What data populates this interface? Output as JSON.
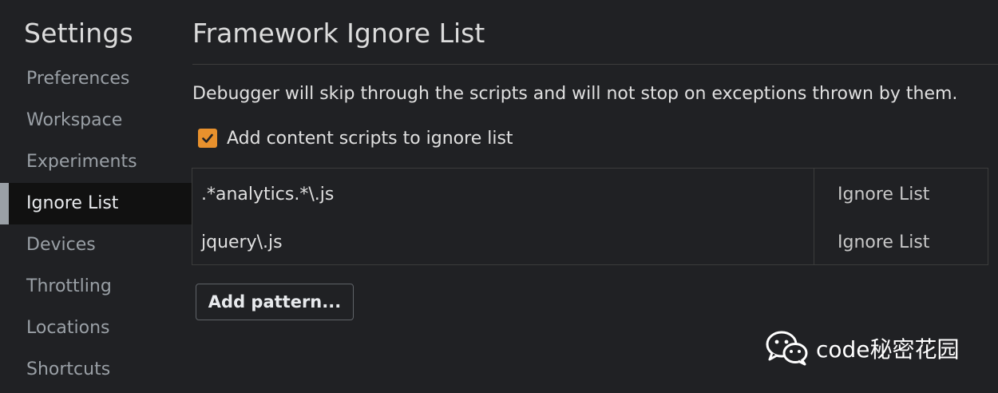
{
  "sidebar": {
    "title": "Settings",
    "items": [
      {
        "label": "Preferences"
      },
      {
        "label": "Workspace"
      },
      {
        "label": "Experiments"
      },
      {
        "label": "Ignore List"
      },
      {
        "label": "Devices"
      },
      {
        "label": "Throttling"
      },
      {
        "label": "Locations"
      },
      {
        "label": "Shortcuts"
      }
    ],
    "selected": "Ignore List"
  },
  "main": {
    "title": "Framework Ignore List",
    "description": "Debugger will skip through the scripts and will not stop on exceptions thrown by them.",
    "checkbox": {
      "label": "Add content scripts to ignore list",
      "checked": true
    },
    "patterns": [
      {
        "pattern": ".*analytics.*\\.js",
        "behavior": "Ignore List"
      },
      {
        "pattern": "jquery\\.js",
        "behavior": "Ignore List"
      }
    ],
    "add_button_label": "Add pattern..."
  },
  "watermark": {
    "text": "code秘密花园",
    "icon": "wechat-icon"
  },
  "colors": {
    "background": "#202124",
    "selected_item_bg": "#111111",
    "checkbox_accent": "#e8912d",
    "border": "#3c3c3c"
  }
}
